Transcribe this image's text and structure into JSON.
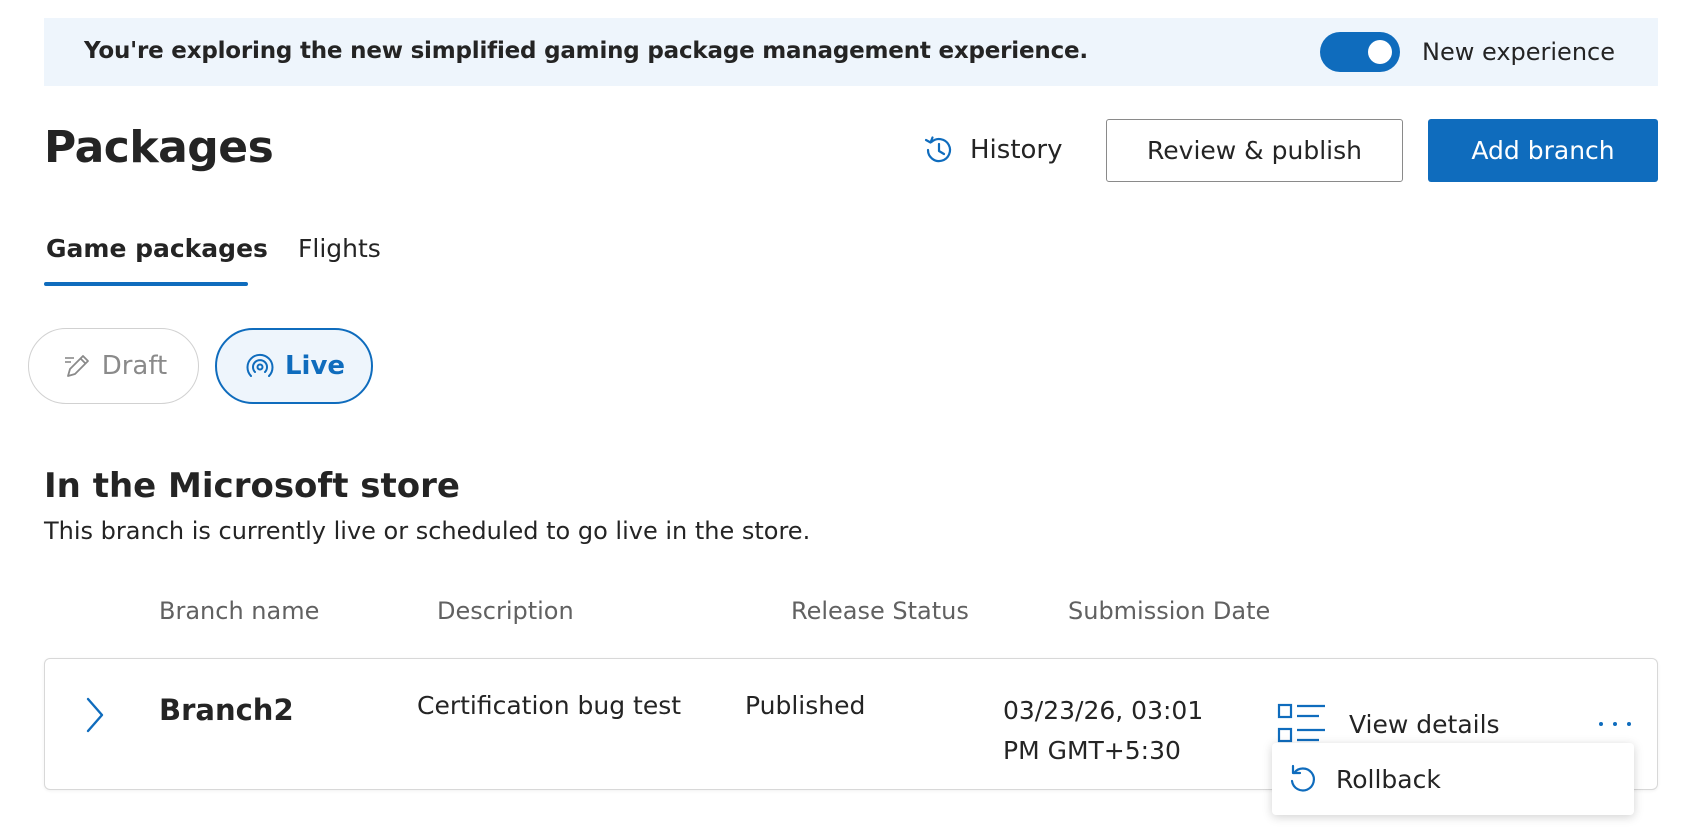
{
  "banner": {
    "text": "You're exploring the new simplified gaming package management experience.",
    "toggle_label": "New experience",
    "toggle_on": true
  },
  "header": {
    "title": "Packages",
    "history_label": "History",
    "review_label": "Review & publish",
    "add_label": "Add branch"
  },
  "tabs": [
    {
      "label": "Game packages",
      "selected": true
    },
    {
      "label": "Flights",
      "selected": false
    }
  ],
  "filters": [
    {
      "label": "Draft",
      "icon": "pencil-icon",
      "selected": false
    },
    {
      "label": "Live",
      "icon": "broadcast-icon",
      "selected": true
    }
  ],
  "section": {
    "title": "In the Microsoft store",
    "subtitle": "This branch is currently live or scheduled to go live in the store."
  },
  "table": {
    "columns": [
      "Branch name",
      "Description",
      "Release Status",
      "Submission Date"
    ],
    "rows": [
      {
        "branch": "Branch2",
        "description": "Certification bug test",
        "status": "Published",
        "date_line1": "03/23/26, 03:01",
        "date_line2": "PM GMT+5:30",
        "action_label": "View details"
      }
    ]
  },
  "menu": {
    "items": [
      {
        "label": "Rollback",
        "icon": "rollback-icon"
      }
    ]
  },
  "colors": {
    "accent": "#0f6cbd",
    "banner_bg": "#eef5fc"
  }
}
